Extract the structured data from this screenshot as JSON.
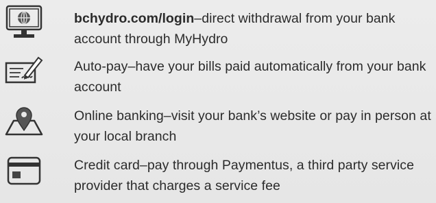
{
  "items": [
    {
      "icon": "computer-monitor-icon",
      "title": "bchydro.com/login",
      "title_bold": true,
      "separator": "–",
      "description": "direct withdrawal from your bank account through MyHydro"
    },
    {
      "icon": "signed-cheque-icon",
      "title": "Auto-pay",
      "title_bold": false,
      "separator": "–",
      "description": "have your bills paid automatically from your bank account"
    },
    {
      "icon": "map-location-pin-icon",
      "title": "Online banking",
      "title_bold": false,
      "separator": "–",
      "description": "visit your bank’s website or pay in person at your local branch"
    },
    {
      "icon": "credit-card-icon",
      "title": "Credit card",
      "title_bold": false,
      "separator": "–",
      "description": "pay through Paymentus, a third party service provider that charges a service fee"
    }
  ]
}
